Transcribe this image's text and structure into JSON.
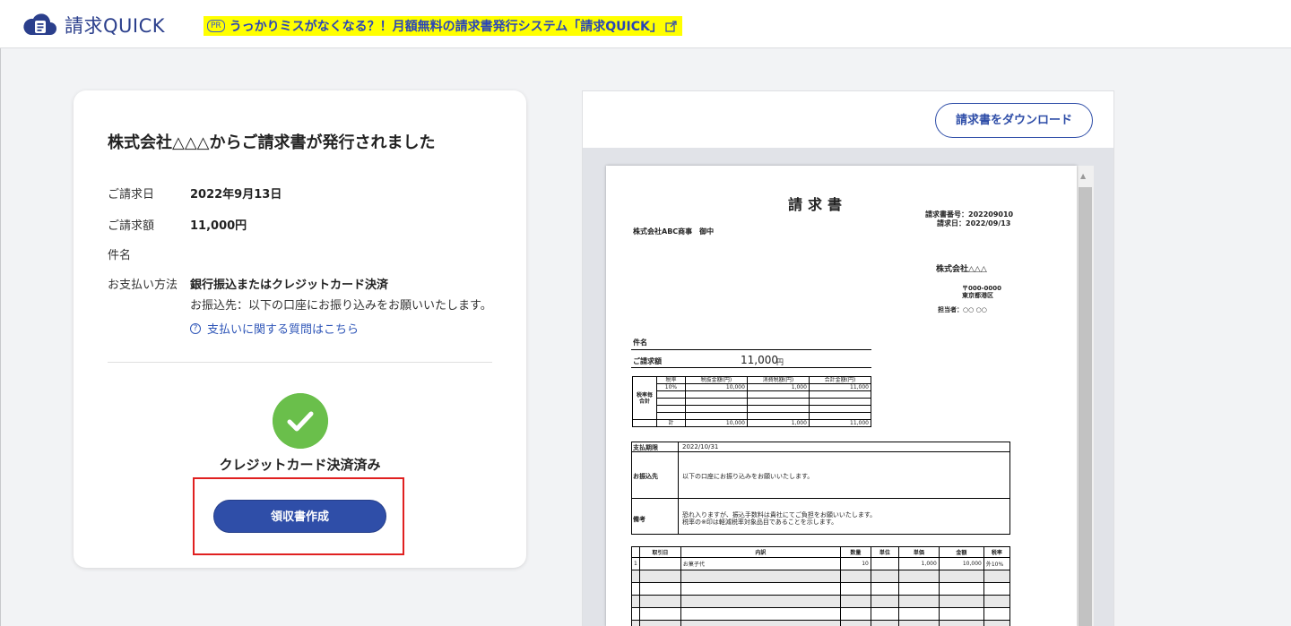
{
  "header": {
    "logo_text": "請求QUICK",
    "pr_tag": "PR",
    "pr_text": "うっかりミスがなくなる？！月額無料の請求書発行システム「請求QUICK」"
  },
  "card": {
    "title": "株式会社△△△からご請求書が発行されました",
    "rows": {
      "date_label": "ご請求日",
      "date_value": "2022年9月13日",
      "amount_label": "ご請求額",
      "amount_value": "11,000円",
      "subject_label": "件名",
      "subject_value": "",
      "method_label": "お支払い方法",
      "method_value": "銀行振込またはクレジットカード決済",
      "method_note": "お振込先：以下の口座にお振り込みをお願いいたします。"
    },
    "faq_link": "支払いに関する質問はこちら",
    "faq_icon": "?",
    "status_text": "クレジットカード決済済み",
    "receipt_button": "領収書作成"
  },
  "preview": {
    "download_button": "請求書をダウンロード",
    "invoice": {
      "title": "請求書",
      "number": "請求書番号：202209010",
      "date": "請求日：2022/09/13",
      "recipient": "株式会社ABC商事　御中",
      "issuer": "株式会社△△△",
      "postal": "〒000-0000",
      "address": "東京都港区",
      "contact": "担当者：○○ ○○",
      "subject_label": "件名",
      "amount_label": "ご請求額",
      "amount_value": "11,000",
      "amount_unit": "円",
      "tax_headers": [
        "税率",
        "税抜金額(円)",
        "消費税額(円)",
        "合計金額(円)"
      ],
      "tax_side_label": "税率毎合計",
      "tax_row": [
        "10%",
        "10,000",
        "1,000",
        "11,000"
      ],
      "tax_total_label": "計",
      "tax_total": [
        "10,000",
        "1,000",
        "11,000"
      ],
      "due_label": "支払期限",
      "due_value": "2022/10/31",
      "bank_label": "お振込先",
      "bank_value": "以下の口座にお振り込みをお願いいたします。",
      "note_label": "備考",
      "note_line1": "恐れ入りますが、振込手数料は貴社にてご負担をお願いいたします。",
      "note_line2": "税率の※印は軽減税率対象品目であることを示します。",
      "item_headers": [
        "",
        "取引日",
        "内訳",
        "数量",
        "単位",
        "単価",
        "金額",
        "税率"
      ],
      "item_row": [
        "1",
        "",
        "お菓子代",
        "10",
        "",
        "1,000",
        "10,000",
        "外10%"
      ]
    }
  },
  "colors": {
    "brand": "#2f4ea8",
    "pr_banner": "#ffff00",
    "check": "#6abf4b",
    "highlight": "#e02020"
  }
}
